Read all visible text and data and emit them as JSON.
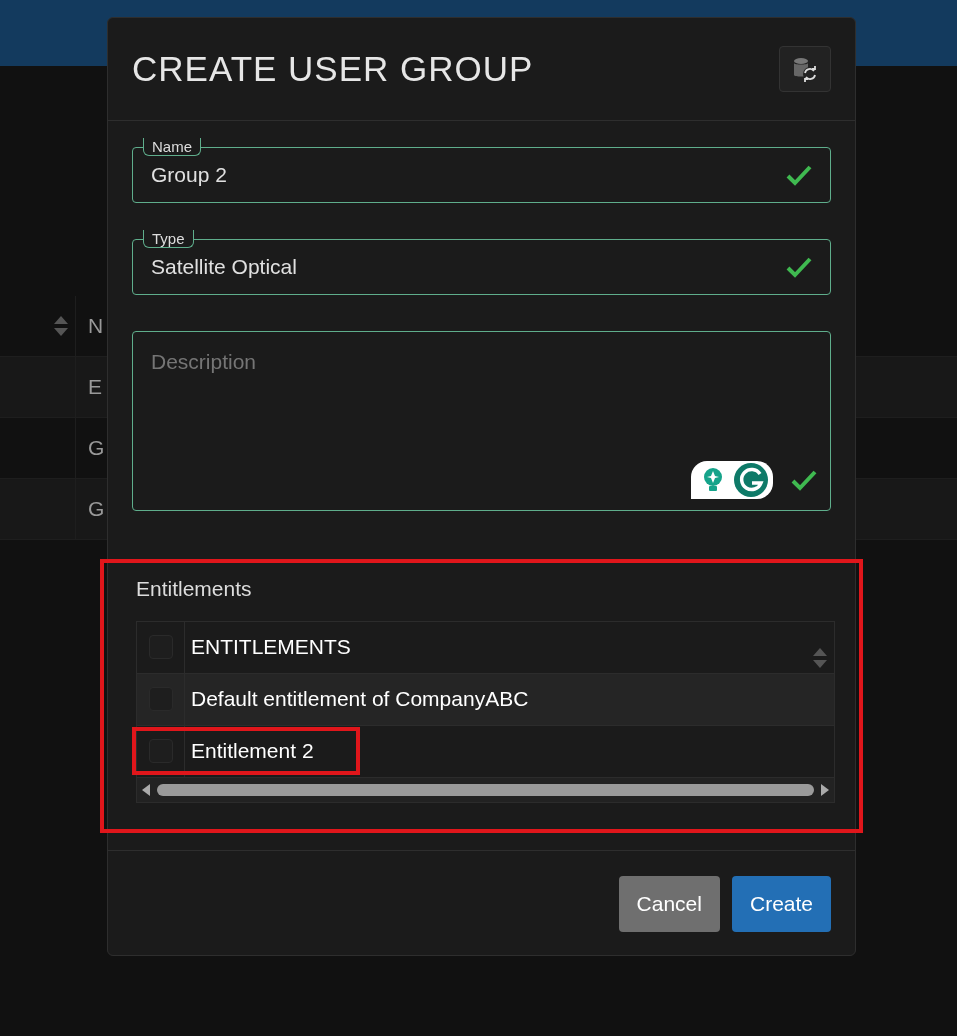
{
  "background_table": {
    "header": "N",
    "rows": [
      "E",
      "G",
      "G"
    ]
  },
  "dialog": {
    "title": "CREATE USER GROUP",
    "fields": [
      {
        "kind": "input",
        "label": "Name",
        "value": "Group 2",
        "valid": true
      },
      {
        "kind": "input",
        "label": "Type",
        "value": "Satellite Optical",
        "valid": true
      },
      {
        "kind": "textarea",
        "placeholder": "Description",
        "valid": true
      }
    ],
    "entitlements": {
      "title": "Entitlements",
      "highlighted": true,
      "table": {
        "column": "ENTITLEMENTS",
        "checked": false,
        "rows": [
          {
            "name": "Default entitlement of CompanyABC",
            "checked": false,
            "highlighted": false
          },
          {
            "name": "Entitlement 2",
            "checked": false,
            "highlighted": true
          }
        ]
      }
    },
    "buttons": [
      {
        "kind": "secondary",
        "label": "Cancel"
      },
      {
        "kind": "primary",
        "label": "Create"
      }
    ]
  }
}
